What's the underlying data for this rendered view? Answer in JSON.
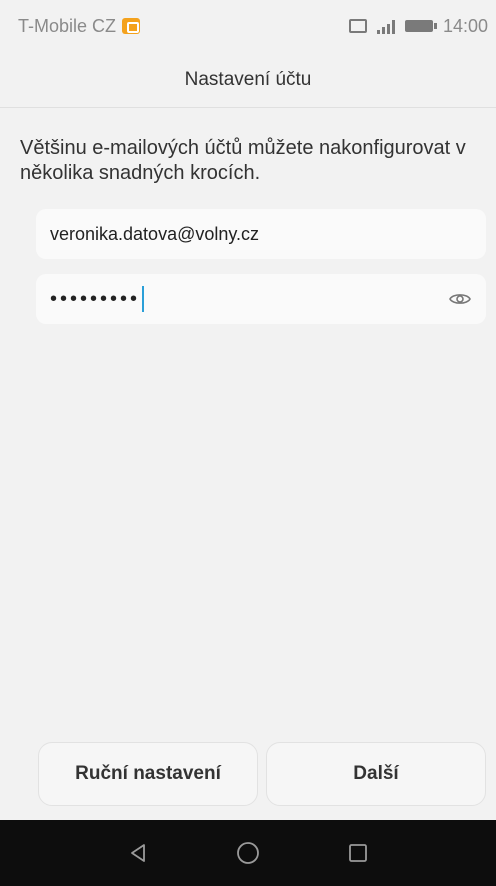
{
  "status_bar": {
    "carrier": "T-Mobile CZ",
    "time": "14:00",
    "icons": [
      "notification-icon",
      "sim-icon",
      "signal-icon",
      "battery-icon"
    ]
  },
  "title_bar": {
    "title": "Nastavení účtu"
  },
  "main": {
    "intro": "Většinu e-mailových účtů můžete nakonfigurovat v několika snadných krocích.",
    "email_field": {
      "value": "veronika.datova@volny.cz"
    },
    "password_field": {
      "masked_value": "•••••••••",
      "toggle_icon": "eye-icon"
    },
    "buttons": {
      "manual": "Ruční nastavení",
      "next": "Další"
    }
  },
  "nav_bar": {
    "icons": [
      "back-icon",
      "home-icon",
      "recents-icon"
    ]
  },
  "colors": {
    "background": "#f2f2f2",
    "field": "#fafafa",
    "caret": "#2a9fd8",
    "nav_bar": "#0d0d0d"
  }
}
